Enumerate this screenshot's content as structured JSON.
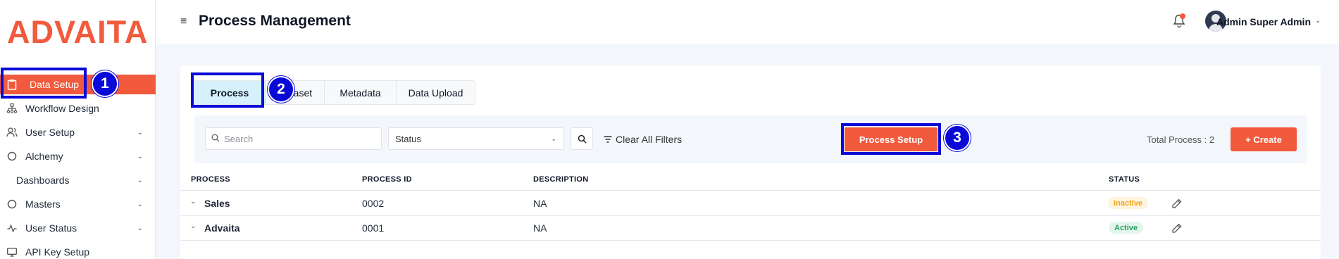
{
  "brand": {
    "logo_text": "ADVAITA",
    "accent": "#f15a3c"
  },
  "sidebar": {
    "items": [
      {
        "label": "Data Setup",
        "icon": "clipboard-icon",
        "active": true,
        "has_chevron": false
      },
      {
        "label": "Workflow Design",
        "icon": "workflow-icon",
        "active": false,
        "has_chevron": false
      },
      {
        "label": "User Setup",
        "icon": "users-icon",
        "active": false,
        "has_chevron": true
      },
      {
        "label": "Alchemy",
        "icon": "circle-icon",
        "active": false,
        "has_chevron": true
      },
      {
        "label": "Dashboards",
        "icon": "",
        "active": false,
        "has_chevron": true
      },
      {
        "label": "Masters",
        "icon": "circle-icon",
        "active": false,
        "has_chevron": true
      },
      {
        "label": "User Status",
        "icon": "activity-icon",
        "active": false,
        "has_chevron": true
      },
      {
        "label": "API Key Setup",
        "icon": "monitor-icon",
        "active": false,
        "has_chevron": false
      }
    ]
  },
  "header": {
    "title": "Process Management",
    "user_name": "Admin Super Admin"
  },
  "tabs": [
    {
      "label": "Process",
      "active": true
    },
    {
      "label": "Dataset",
      "active": false
    },
    {
      "label": "Metadata",
      "active": false
    },
    {
      "label": "Data Upload",
      "active": false
    }
  ],
  "filters": {
    "search_placeholder": "Search",
    "status_value": "Status",
    "clear_label": "Clear All Filters",
    "process_setup_label": "Process Setup",
    "total_label": "Total Process : 2",
    "create_label": "+ Create"
  },
  "table": {
    "headers": [
      "PROCESS",
      "PROCESS ID",
      "DESCRIPTION",
      "STATUS"
    ],
    "rows": [
      {
        "process": "Sales",
        "process_id": "0002",
        "description": "NA",
        "status": "Inactive"
      },
      {
        "process": "Advaita",
        "process_id": "0001",
        "description": "NA",
        "status": "Active"
      }
    ]
  },
  "annotations": [
    "1",
    "2",
    "3"
  ],
  "colors": {
    "annotation": "#0a0ad8",
    "inactive": "#f1a51a",
    "active": "#2e9f63"
  }
}
